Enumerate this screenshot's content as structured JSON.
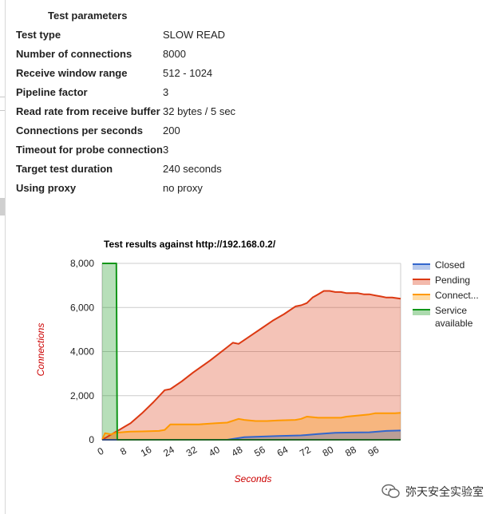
{
  "parameters": {
    "title": "Test parameters",
    "rows": [
      {
        "label": "Test type",
        "value": "SLOW READ"
      },
      {
        "label": "Number of connections",
        "value": "8000"
      },
      {
        "label": "Receive window range",
        "value": "512 - 1024"
      },
      {
        "label": "Pipeline factor",
        "value": "3"
      },
      {
        "label": "Read rate from receive buffer",
        "value": "32 bytes / 5 sec"
      },
      {
        "label": "Connections per seconds",
        "value": "200"
      },
      {
        "label": "Timeout for probe connection",
        "value": "3"
      },
      {
        "label": "Target test duration",
        "value": "240 seconds"
      },
      {
        "label": "Using proxy",
        "value": "no proxy"
      }
    ]
  },
  "chart_data": {
    "type": "area",
    "title": "Test results against http://192.168.0.2/",
    "xlabel": "Seconds",
    "ylabel": "Connections",
    "xlim": [
      0,
      105
    ],
    "ylim": [
      0,
      8000
    ],
    "x_ticks": [
      "0",
      "8",
      "16",
      "24",
      "32",
      "40",
      "48",
      "56",
      "64",
      "72",
      "80",
      "88",
      "96"
    ],
    "y_ticks": [
      "0",
      "2,000",
      "4,000",
      "6,000",
      "8,000"
    ],
    "grid": true,
    "legend_position": "right",
    "colors": {
      "closed": "#3366cc",
      "pending": "#dc3912",
      "connected": "#ff9900",
      "service": "#109618",
      "axis_label": "#cc0000"
    },
    "legend": [
      {
        "key": "closed",
        "lines": [
          "Closed"
        ]
      },
      {
        "key": "pending",
        "lines": [
          "Pending"
        ]
      },
      {
        "key": "connected",
        "lines": [
          "Connect..."
        ]
      },
      {
        "key": "service",
        "lines": [
          "Service",
          "available"
        ]
      }
    ],
    "series": [
      {
        "key": "closed",
        "x": [
          0,
          44,
          50,
          55,
          62,
          70,
          76,
          82,
          88,
          94,
          100,
          105
        ],
        "y": [
          0,
          0,
          120,
          140,
          170,
          200,
          260,
          320,
          330,
          340,
          400,
          420
        ]
      },
      {
        "key": "pending",
        "x": [
          0,
          2,
          4,
          6,
          8,
          10,
          14,
          18,
          22,
          24,
          28,
          32,
          38,
          44,
          46,
          48,
          52,
          56,
          60,
          64,
          68,
          70,
          72,
          74,
          76,
          78,
          80,
          82,
          84,
          86,
          88,
          90,
          92,
          94,
          96,
          98,
          100,
          102,
          105
        ],
        "y": [
          0,
          150,
          300,
          450,
          600,
          750,
          1200,
          1700,
          2250,
          2300,
          2650,
          3050,
          3600,
          4200,
          4400,
          4350,
          4700,
          5050,
          5400,
          5700,
          6050,
          6100,
          6200,
          6450,
          6600,
          6750,
          6750,
          6700,
          6700,
          6650,
          6650,
          6650,
          6600,
          6600,
          6550,
          6500,
          6450,
          6450,
          6400
        ]
      },
      {
        "key": "connected",
        "x": [
          0,
          1,
          3,
          5,
          6,
          8,
          10,
          14,
          20,
          22,
          24,
          28,
          34,
          40,
          44,
          48,
          50,
          54,
          58,
          62,
          68,
          70,
          72,
          76,
          80,
          84,
          86,
          90,
          94,
          96,
          100,
          103,
          105
        ],
        "y": [
          0,
          300,
          250,
          320,
          330,
          350,
          370,
          380,
          400,
          450,
          700,
          700,
          700,
          750,
          780,
          950,
          900,
          850,
          850,
          880,
          900,
          950,
          1050,
          1000,
          1000,
          1000,
          1050,
          1100,
          1150,
          1200,
          1200,
          1200,
          1220
        ]
      },
      {
        "key": "service",
        "x": [
          0,
          5,
          5.3,
          6,
          105
        ],
        "y": [
          8000,
          8000,
          0,
          0,
          0
        ]
      }
    ]
  },
  "watermark": {
    "text": "弥天安全实验室",
    "icon": "wechat-logo-icon"
  }
}
